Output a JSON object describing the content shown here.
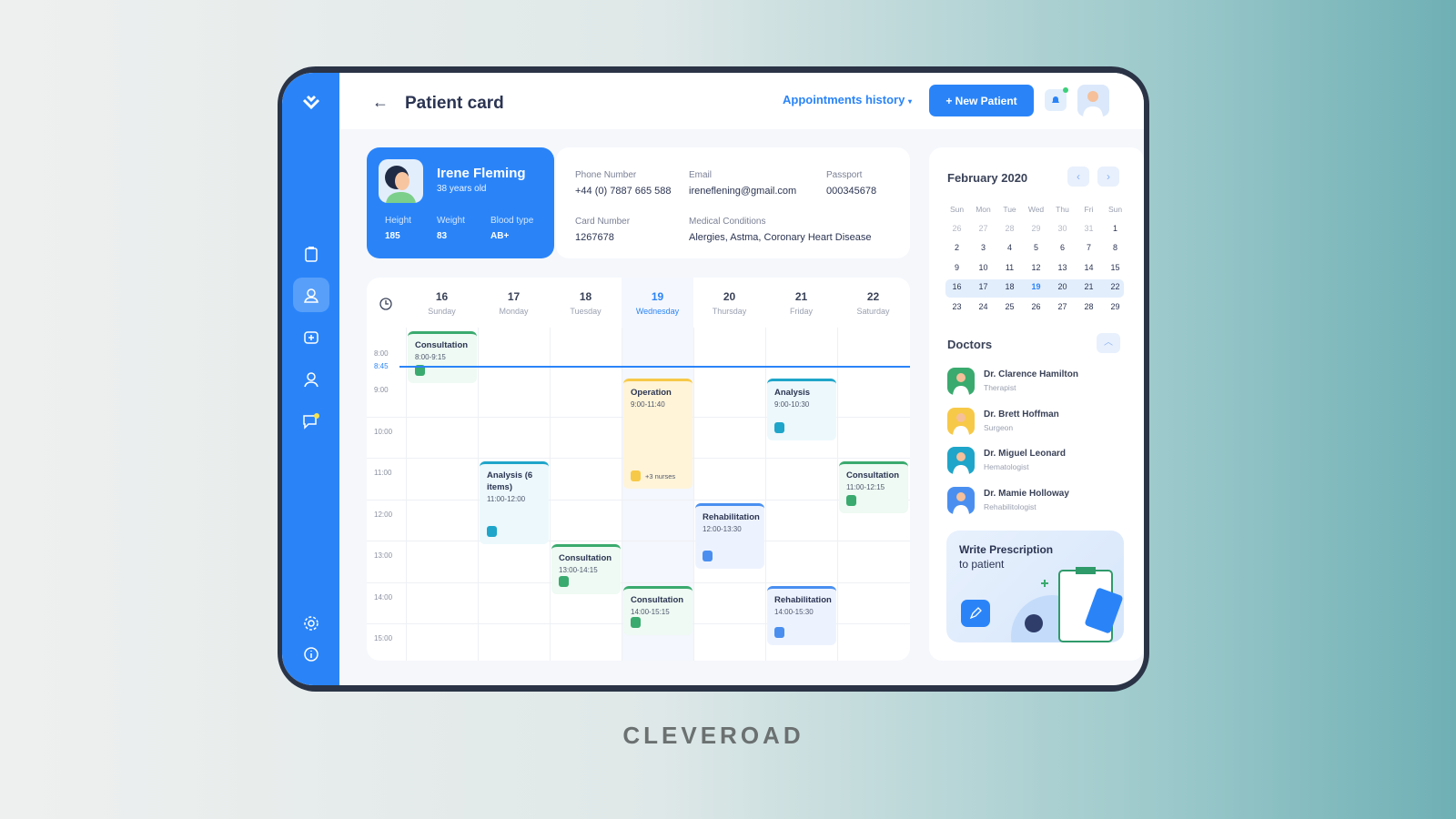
{
  "header": {
    "title": "Patient card",
    "appointments_history": "Appointments history",
    "new_patient": "+ New Patient"
  },
  "patient": {
    "name": "Irene Fleming",
    "age": "38 years old",
    "height_label": "Height",
    "height": "185",
    "weight_label": "Weight",
    "weight": "83",
    "blood_label": "Blood type",
    "blood": "AB+"
  },
  "info": {
    "phone_label": "Phone Number",
    "phone": "+44 (0) 7887 665 588",
    "email_label": "Email",
    "email": "ireneflening@gmail.com",
    "passport_label": "Passport",
    "passport": "000345678",
    "card_label": "Card Number",
    "card": "1267678",
    "conditions_label": "Medical Conditions",
    "conditions": "Alergies, Astma, Coronary Heart Disease"
  },
  "schedule": {
    "days": [
      {
        "n": "16",
        "d": "Sunday"
      },
      {
        "n": "17",
        "d": "Monday"
      },
      {
        "n": "18",
        "d": "Tuesday"
      },
      {
        "n": "19",
        "d": "Wednesday",
        "today": true
      },
      {
        "n": "20",
        "d": "Thursday"
      },
      {
        "n": "21",
        "d": "Friday"
      },
      {
        "n": "22",
        "d": "Saturday"
      }
    ],
    "hours": [
      "8:00",
      "9:00",
      "10:00",
      "11:00",
      "12:00",
      "13:00",
      "14:00",
      "15:00"
    ],
    "now": "8:45",
    "events": [
      {
        "day": 0,
        "title": "Consultation",
        "time": "8:00-9:15",
        "start": 8,
        "end": 9.25,
        "kind": "consult"
      },
      {
        "day": 3,
        "title": "Operation",
        "time": "9:00-11:40",
        "start": 9,
        "end": 11.67,
        "kind": "operation",
        "extra": "+3 nurses"
      },
      {
        "day": 5,
        "title": "Analysis",
        "time": "9:00-10:30",
        "start": 9,
        "end": 10.5,
        "kind": "analysis"
      },
      {
        "day": 1,
        "title": "Analysis (6 items)",
        "time": "11:00-12:00",
        "start": 11,
        "end": 13,
        "kind": "analysis"
      },
      {
        "day": 6,
        "title": "Consultation",
        "time": "11:00-12:15",
        "start": 11,
        "end": 12.25,
        "kind": "consult"
      },
      {
        "day": 4,
        "title": "Rehabilitation",
        "time": "12:00-13:30",
        "start": 12,
        "end": 13.6,
        "kind": "rehab"
      },
      {
        "day": 2,
        "title": "Consultation",
        "time": "13:00-14:15",
        "start": 13,
        "end": 14.2,
        "kind": "consult"
      },
      {
        "day": 3,
        "title": "Consultation",
        "time": "14:00-15:15",
        "start": 14,
        "end": 15.2,
        "kind": "consult"
      },
      {
        "day": 5,
        "title": "Rehabilitation",
        "time": "14:00-15:30",
        "start": 14,
        "end": 15.45,
        "kind": "rehab"
      }
    ]
  },
  "calendar": {
    "title": "February 2020",
    "weekdays": [
      "Sun",
      "Mon",
      "Tue",
      "Wed",
      "Thu",
      "Fri",
      "Sun"
    ],
    "weeks": [
      [
        "26",
        "27",
        "28",
        "29",
        "30",
        "31",
        "1"
      ],
      [
        "2",
        "3",
        "4",
        "5",
        "6",
        "7",
        "8"
      ],
      [
        "9",
        "10",
        "11",
        "12",
        "13",
        "14",
        "15"
      ],
      [
        "16",
        "17",
        "18",
        "19",
        "20",
        "21",
        "22"
      ],
      [
        "23",
        "24",
        "25",
        "26",
        "27",
        "28",
        "29"
      ]
    ],
    "selected_week": 3,
    "today": "19"
  },
  "doctors": {
    "title": "Doctors",
    "items": [
      {
        "name": "Dr. Clarence Hamilton",
        "specialty": "Therapist",
        "color": "#3aaa6e"
      },
      {
        "name": "Dr. Brett Hoffman",
        "specialty": "Surgeon",
        "color": "#f7c948"
      },
      {
        "name": "Dr. Miguel Leonard",
        "specialty": "Hematologist",
        "color": "#1fa5c9"
      },
      {
        "name": "Dr. Mamie Holloway",
        "specialty": "Rehabilitologist",
        "color": "#4a8ff0"
      }
    ]
  },
  "prescription": {
    "title": "Write Prescription",
    "subtitle": "to patient"
  },
  "brand": "CLEVEROAD",
  "colors": {
    "accent": "#2a84f8",
    "consult": "#3aaa6e",
    "operation": "#f7c948",
    "analysis": "#1fa5c9",
    "rehab": "#4a8ff0"
  }
}
